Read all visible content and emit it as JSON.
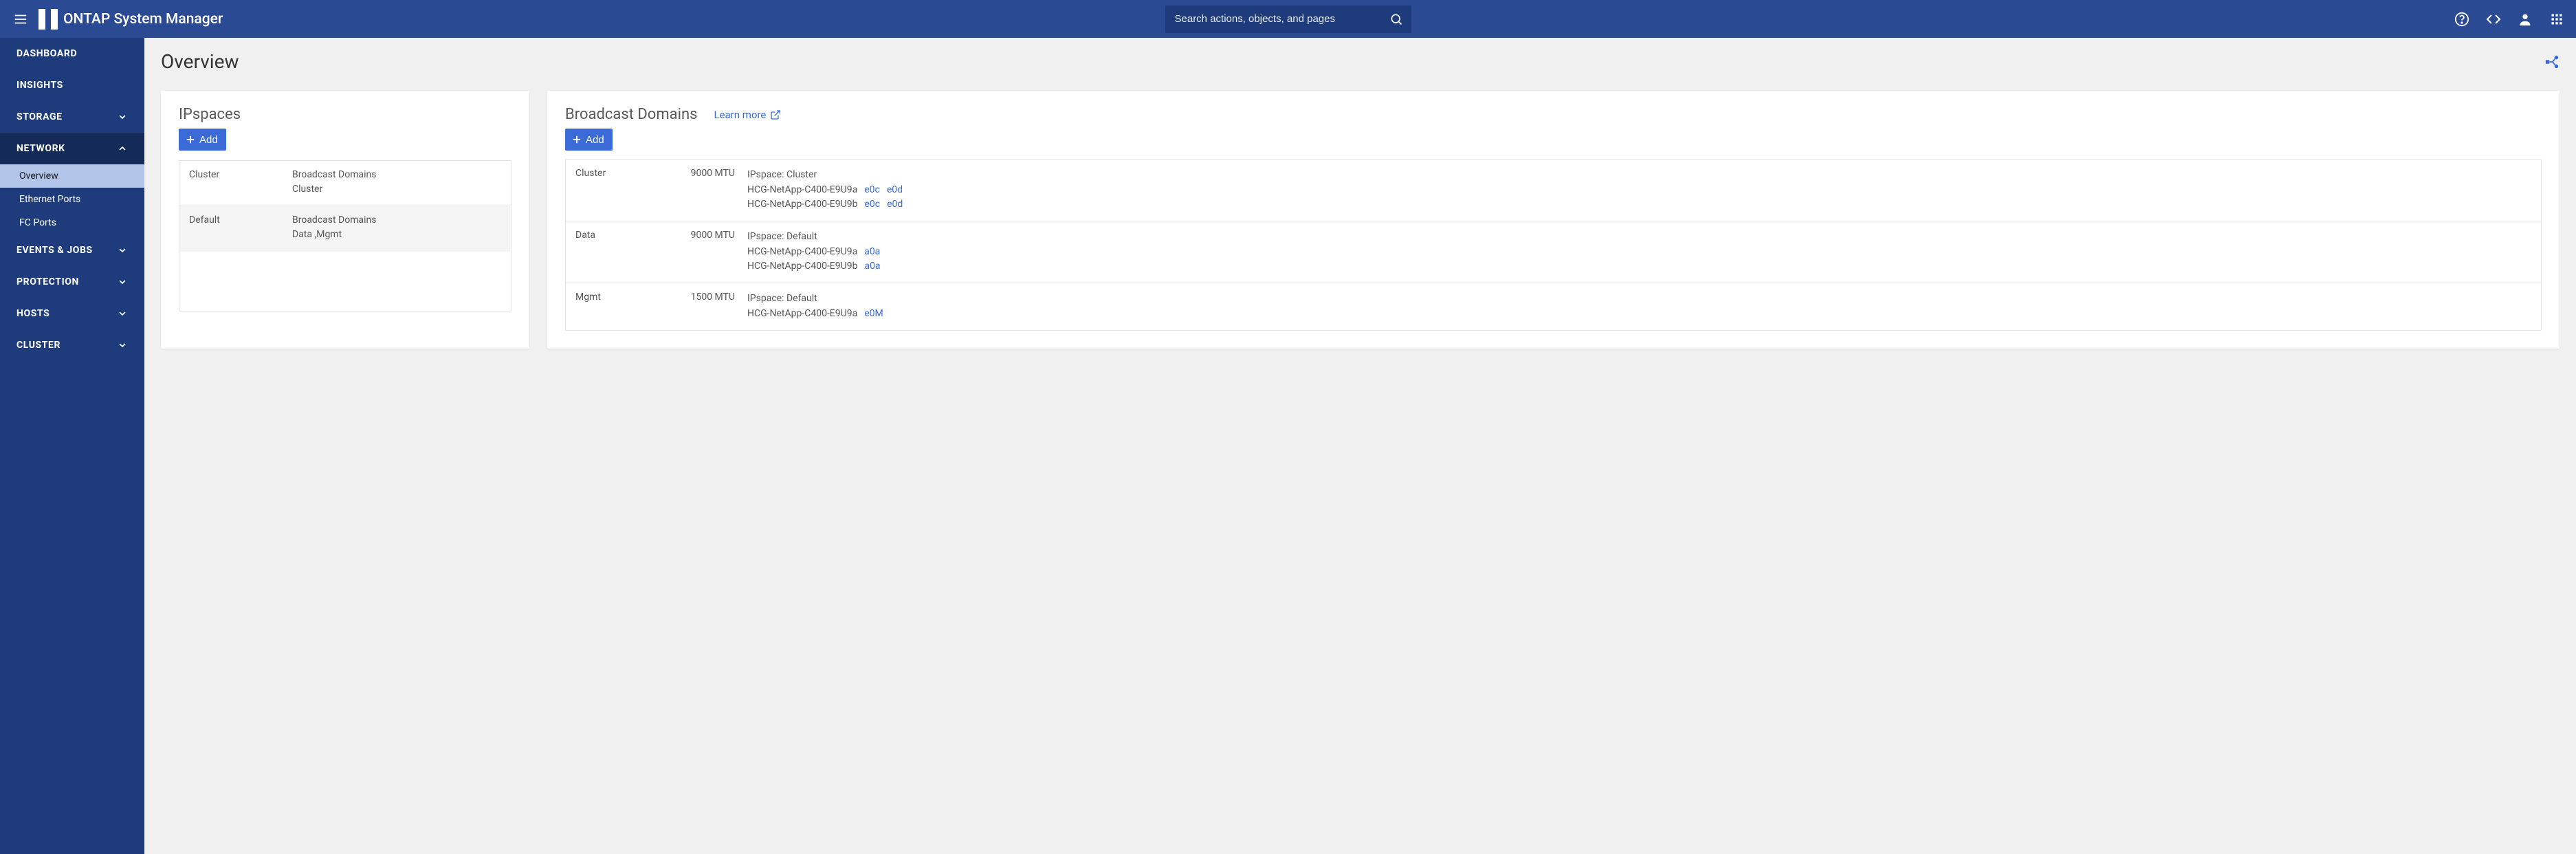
{
  "brand": {
    "title": "ONTAP System Manager"
  },
  "search": {
    "placeholder": "Search actions, objects, and pages"
  },
  "sidebar": {
    "items": [
      {
        "label": "Dashboard",
        "expandable": false
      },
      {
        "label": "Insights",
        "expandable": false
      },
      {
        "label": "Storage",
        "expandable": true,
        "open": false
      },
      {
        "label": "Network",
        "expandable": true,
        "open": true,
        "active": true,
        "children": [
          {
            "label": "Overview",
            "active": true
          },
          {
            "label": "Ethernet Ports",
            "active": false
          },
          {
            "label": "FC Ports",
            "active": false
          }
        ]
      },
      {
        "label": "Events & Jobs",
        "expandable": true,
        "open": false
      },
      {
        "label": "Protection",
        "expandable": true,
        "open": false
      },
      {
        "label": "Hosts",
        "expandable": true,
        "open": false
      },
      {
        "label": "Cluster",
        "expandable": true,
        "open": false
      }
    ]
  },
  "page": {
    "title": "Overview"
  },
  "ipspaces": {
    "title": "IPspaces",
    "add_label": "Add",
    "rows": [
      {
        "name": "Cluster",
        "desc_title": "Broadcast Domains",
        "desc_sub": "Cluster"
      },
      {
        "name": "Default",
        "desc_title": "Broadcast Domains",
        "desc_sub": "Data ,Mgmt"
      }
    ]
  },
  "broadcast": {
    "title": "Broadcast Domains",
    "learn_label": "Learn more",
    "add_label": "Add",
    "rows": [
      {
        "name": "Cluster",
        "mtu": "9000 MTU",
        "ipspace": "IPspace: Cluster",
        "nodes": [
          {
            "node": "HCG-NetApp-C400-E9U9a",
            "ports": [
              "e0c",
              "e0d"
            ]
          },
          {
            "node": "HCG-NetApp-C400-E9U9b",
            "ports": [
              "e0c",
              "e0d"
            ]
          }
        ]
      },
      {
        "name": "Data",
        "mtu": "9000 MTU",
        "ipspace": "IPspace: Default",
        "nodes": [
          {
            "node": "HCG-NetApp-C400-E9U9a",
            "ports": [
              "a0a"
            ]
          },
          {
            "node": "HCG-NetApp-C400-E9U9b",
            "ports": [
              "a0a"
            ]
          }
        ]
      },
      {
        "name": "Mgmt",
        "mtu": "1500 MTU",
        "ipspace": "IPspace: Default",
        "nodes": [
          {
            "node": "HCG-NetApp-C400-E9U9a",
            "ports": [
              "e0M"
            ]
          }
        ]
      }
    ]
  }
}
